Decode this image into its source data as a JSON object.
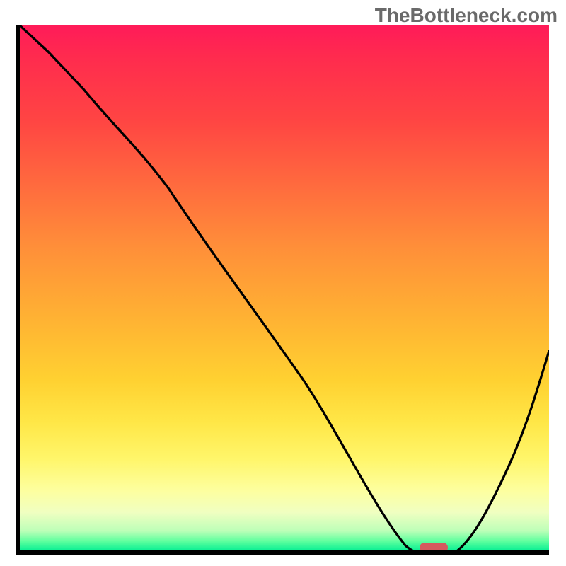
{
  "watermark": "TheBottleneck.com",
  "chart_data": {
    "type": "line",
    "title": "",
    "xlabel": "",
    "ylabel": "",
    "xlim": [
      0,
      100
    ],
    "ylim": [
      0,
      100
    ],
    "grid": false,
    "legend": false,
    "background_gradient": {
      "direction": "vertical",
      "stops": [
        {
          "pos": 0,
          "color": "#ff1b59"
        },
        {
          "pos": 18,
          "color": "#ff4543"
        },
        {
          "pos": 42,
          "color": "#ff8f39"
        },
        {
          "pos": 67,
          "color": "#ffd131"
        },
        {
          "pos": 82,
          "color": "#fff66b"
        },
        {
          "pos": 95,
          "color": "#bcffb8"
        },
        {
          "pos": 100,
          "color": "#07dc86"
        }
      ]
    },
    "series": [
      {
        "name": "bottleneck-curve",
        "x": [
          0,
          5,
          12,
          22,
          30,
          40,
          50,
          60,
          68,
          72,
          77,
          82,
          88,
          94,
          100
        ],
        "y": [
          100,
          95,
          88,
          78,
          70,
          56,
          42,
          28,
          13,
          3,
          0,
          0,
          10,
          25,
          42
        ],
        "color": "#000000"
      }
    ],
    "marker": {
      "name": "selected-point",
      "x": 78,
      "y": 0,
      "color": "#d55a5e"
    }
  }
}
